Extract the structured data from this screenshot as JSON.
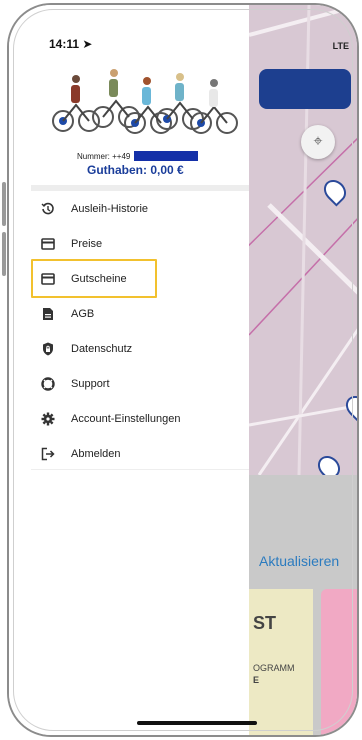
{
  "status_bar": {
    "time": "14:11",
    "network": "LTE"
  },
  "account": {
    "number_label": "Nummer: ++49",
    "balance": "Guthaben: 0,00 €"
  },
  "menu": [
    {
      "label": "Ausleih-Historie",
      "icon": "history-icon"
    },
    {
      "label": "Preise",
      "icon": "card-icon"
    },
    {
      "label": "Gutscheine",
      "icon": "card-icon"
    },
    {
      "label": "AGB",
      "icon": "document-icon"
    },
    {
      "label": "Datenschutz",
      "icon": "shield-lock-icon"
    },
    {
      "label": "Support",
      "icon": "lifebuoy-icon"
    },
    {
      "label": "Account-Einstellungen",
      "icon": "gear-icon"
    },
    {
      "label": "Abmelden",
      "icon": "logout-icon"
    }
  ],
  "background": {
    "refresh_label": "Aktualisieren",
    "card_text": [
      "ST",
      "OGRAMM",
      "E"
    ]
  },
  "colors": {
    "accent": "#1a3d9a",
    "highlight": "#f2c12e",
    "map": "#d8c8d3"
  }
}
